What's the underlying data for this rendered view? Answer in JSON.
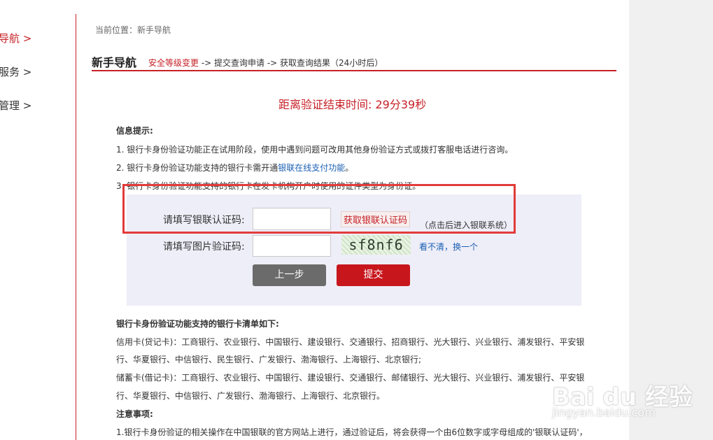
{
  "sidebar": {
    "items": [
      {
        "label": "导航 >"
      },
      {
        "label": "服务 >"
      },
      {
        "label": "管理 >"
      }
    ]
  },
  "breadcrumb": "当前位置：新手导航",
  "page_title": "新手导航",
  "steps": {
    "step1": "安全等级变更",
    "rest": " -> 提交查询申请 -> 获取查询结果（24小时后）"
  },
  "countdown": "距离验证结束时间:  29分39秒",
  "info": {
    "title": "信息提示:",
    "line1": "1. 银行卡身份验证功能正在试用阶段，使用中遇到问题可改用其他身份验证方式或拨打客服电话进行咨询。",
    "line2_pre": "2. 银行卡身份验证功能支持的银行卡需开通",
    "line2_link": "银联在线支付功能",
    "line2_post": "。",
    "line3": "3. 银行卡身份验证功能支持的银行卡在发卡机构开户时使用的证件类型为身份证。"
  },
  "form": {
    "unionpay_label": "请填写银联认证码:",
    "unionpay_value": "",
    "get_code_label": "获取银联认证码",
    "hint": "（点击后进入银联系统）",
    "captcha_label": "请填写图片验证码:",
    "captcha_value": "",
    "captcha_text": "sf8nf6",
    "refresh_label": "看不清，换一个",
    "prev_label": "上一步",
    "submit_label": "提交"
  },
  "banks": {
    "title": "银行卡身份验证功能支持的银行卡清单如下:",
    "credit1": "信用卡(贷记卡)：工商银行、农业银行、中国银行、建设银行、交通银行、招商银行、光大银行、兴业银行、浦发银行、平安银",
    "credit2": "行、华夏银行、中信银行、民生银行、广发银行、渤海银行、上海银行、北京银行;",
    "debit1": "储蓄卡(借记卡)：工商银行、农业银行、中国银行、建设银行、交通银行、邮储银行、光大银行、兴业银行、浦发银行、平安银",
    "debit2": "行、华夏银行、中信银行、广发银行、渤海银行、上海银行、北京银行。"
  },
  "notes": {
    "title": "注意事项:",
    "line1": "1.银行卡身份验证的相关操作在中国银联的官方网站上进行，通过验证后，将会获得一个由6位数字或字母组成的'银联认证码'，"
  },
  "watermark": {
    "logo": "Bai du 经验",
    "url": "jingyan.baidu.com"
  },
  "colors": {
    "accent": "#c62127",
    "link": "#1a5fb4",
    "panel_bg": "#eeeef8",
    "highlight": "#e23b3b"
  }
}
